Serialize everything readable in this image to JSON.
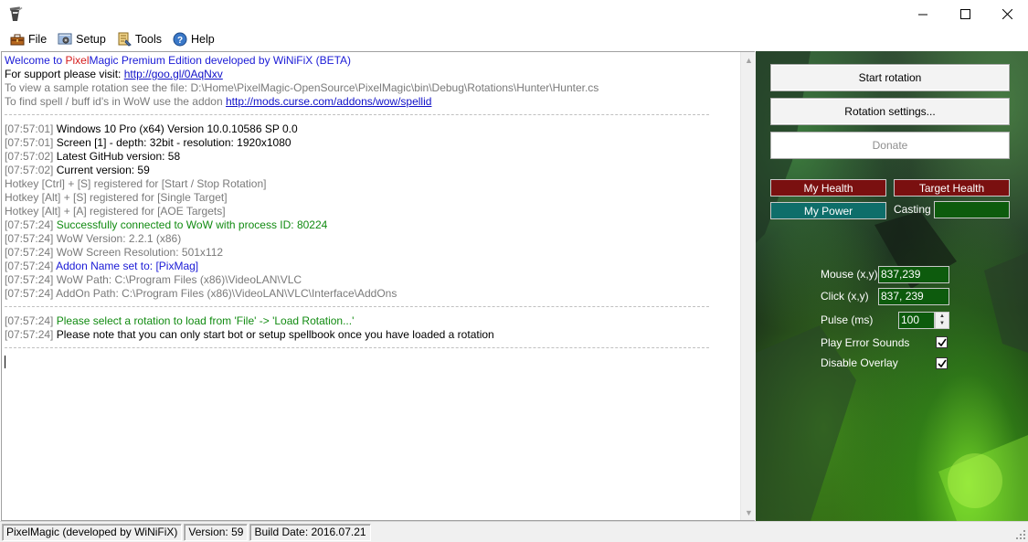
{
  "window": {
    "minimize_glyph": "—",
    "maximize_glyph": "☐",
    "close_glyph": "✕"
  },
  "menu": [
    {
      "label": "File",
      "icon": "toolbox-icon"
    },
    {
      "label": "Setup",
      "icon": "setup-icon"
    },
    {
      "label": "Tools",
      "icon": "tools-icon"
    },
    {
      "label": "Help",
      "icon": "help-icon"
    }
  ],
  "log": {
    "welcome_prefix": "Welcome to ",
    "welcome_pixel": "Pixel",
    "welcome_magic": "Magic",
    "welcome_rest": " Premium Edition developed by WiNiFiX (BETA)",
    "support_text": "For support please visit: ",
    "support_link": "http://goo.gl/0AqNxv",
    "sample_text": "To view a sample rotation see the file: D:\\Home\\PixelMagic-OpenSource\\PixelMagic\\bin\\Debug\\Rotations\\Hunter\\Hunter.cs",
    "spell_text": "To find spell / buff id's in WoW use the addon ",
    "spell_link": "http://mods.curse.com/addons/wow/spellid",
    "entries1": [
      {
        "ts": "[07:57:01]",
        "msg": " Windows 10 Pro (x64) Version 10.0.10586 SP 0.0",
        "color": "black"
      },
      {
        "ts": "[07:57:01]",
        "msg": " Screen [1] - depth: 32bit - resolution: 1920x1080",
        "color": "black"
      },
      {
        "ts": "[07:57:02]",
        "msg": " Latest GitHub version: 58",
        "color": "black"
      },
      {
        "ts": "[07:57:02]",
        "msg": " Current version: 59",
        "color": "black"
      },
      {
        "ts": "",
        "msg": "Hotkey [Ctrl] + [S] registered for [Start / Stop Rotation]",
        "color": "gray"
      },
      {
        "ts": "",
        "msg": "Hotkey [Alt] + [S] registered for [Single Target]",
        "color": "gray"
      },
      {
        "ts": "",
        "msg": "Hotkey [Alt] + [A] registered for [AOE Targets]",
        "color": "gray"
      },
      {
        "ts": "[07:57:24]",
        "msg": " Successfully connected to WoW with process ID: 80224",
        "color": "green"
      },
      {
        "ts": "[07:57:24]",
        "msg": " WoW Version: 2.2.1 (x86)",
        "color": "gray"
      },
      {
        "ts": "[07:57:24]",
        "msg": " WoW Screen Resolution: 501x112",
        "color": "gray"
      },
      {
        "ts": "[07:57:24]",
        "msg": " Addon Name set to: [PixMag]",
        "color": "blue"
      },
      {
        "ts": "[07:57:24]",
        "msg": " WoW Path: C:\\Program Files (x86)\\VideoLAN\\VLC",
        "color": "gray"
      },
      {
        "ts": "[07:57:24]",
        "msg": " AddOn Path: C:\\Program Files (x86)\\VideoLAN\\VLC\\Interface\\AddOns",
        "color": "gray"
      }
    ],
    "entries2": [
      {
        "ts": "[07:57:24]",
        "msg": " Please select a rotation to load from 'File' -> 'Load Rotation...'",
        "color": "green"
      },
      {
        "ts": "[07:57:24]",
        "msg": " Please note that you can only start bot or setup spellbook once you have loaded a rotation",
        "color": "black"
      }
    ]
  },
  "panel": {
    "start_rotation": "Start rotation",
    "rotation_settings": "Rotation settings...",
    "donate": "Donate",
    "my_health": "My Health",
    "target_health": "Target Health",
    "my_power": "My Power",
    "casting": "Casting",
    "mouse_label": "Mouse (x,y)",
    "mouse_value": "837,239",
    "click_label": "Click (x,y)",
    "click_value": "837, 239",
    "pulse_label": "Pulse (ms)",
    "pulse_value": "100",
    "play_error_sounds": "Play Error Sounds",
    "play_error_sounds_checked": true,
    "disable_overlay": "Disable Overlay",
    "disable_overlay_checked": true,
    "colors": {
      "health": "#7a1010",
      "power": "#0e6e6a",
      "casting": "#0d5b0d"
    }
  },
  "status": {
    "app": "PixelMagic (developed by WiNiFiX)",
    "version": "Version: 59",
    "build": "Build Date: 2016.07.21"
  }
}
